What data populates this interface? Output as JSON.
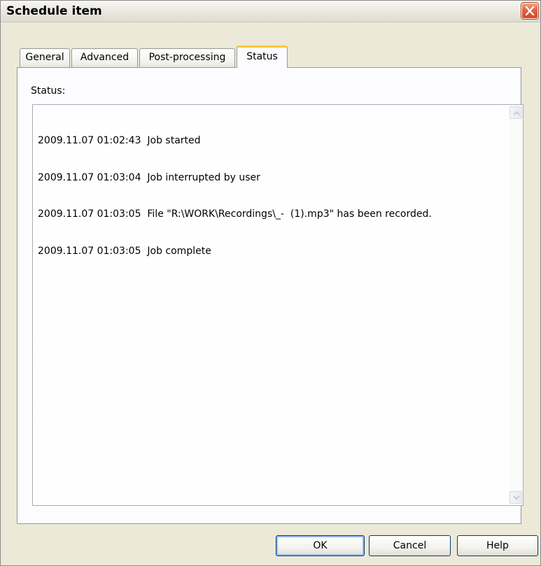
{
  "window": {
    "title": "Schedule item"
  },
  "tabs": [
    {
      "label": "General",
      "active": false
    },
    {
      "label": "Advanced",
      "active": false
    },
    {
      "label": "Post-processing",
      "active": false
    },
    {
      "label": "Status",
      "active": true
    }
  ],
  "status": {
    "label": "Status:",
    "lines": [
      "2009.11.07 01:02:43  Job started",
      "2009.11.07 01:03:04  Job interrupted by user",
      "2009.11.07 01:03:05  File \"R:\\WORK\\Recordings\\_-  (1).mp3\" has been recorded.",
      "2009.11.07 01:03:05  Job complete"
    ]
  },
  "buttons": {
    "ok": "OK",
    "cancel": "Cancel",
    "help": "Help"
  },
  "colors": {
    "window_bg": "#ece9d8",
    "active_tab_accent": "#ffc83c",
    "close_button": "#d14a25"
  },
  "icons": {
    "close": "close-icon",
    "scroll_up": "chevron-up-icon",
    "scroll_down": "chevron-down-icon"
  }
}
